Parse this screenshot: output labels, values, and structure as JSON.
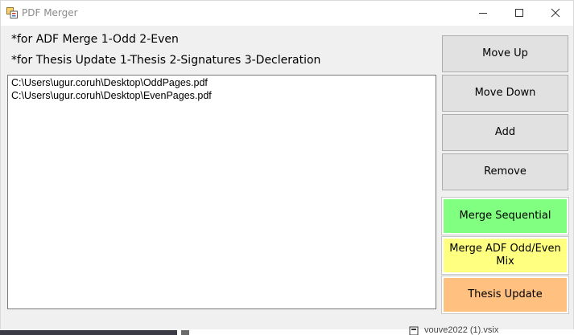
{
  "window": {
    "title": "PDF Merger",
    "controls": [
      "minimize",
      "maximize",
      "close"
    ]
  },
  "notes": {
    "line1": "*for ADF Merge 1-Odd 2-Even",
    "line2": "*for Thesis Update 1-Thesis 2-Signatures 3-Decleration"
  },
  "files": [
    "C:\\Users\\ugur.coruh\\Desktop\\OddPages.pdf",
    "C:\\Users\\ugur.coruh\\Desktop\\EvenPages.pdf"
  ],
  "buttons": {
    "move_up": "Move Up",
    "move_down": "Move Down",
    "add": "Add",
    "remove": "Remove",
    "merge_sequential": "Merge Sequential",
    "merge_adf": "Merge ADF Odd/Even Mix",
    "thesis_update": "Thesis Update"
  },
  "colors": {
    "merge_sequential": "#80ff80",
    "merge_adf": "#ffff80",
    "thesis_update": "#ffc080"
  },
  "background_window": {
    "partial_text": "vouve2022 (1).vsix"
  }
}
